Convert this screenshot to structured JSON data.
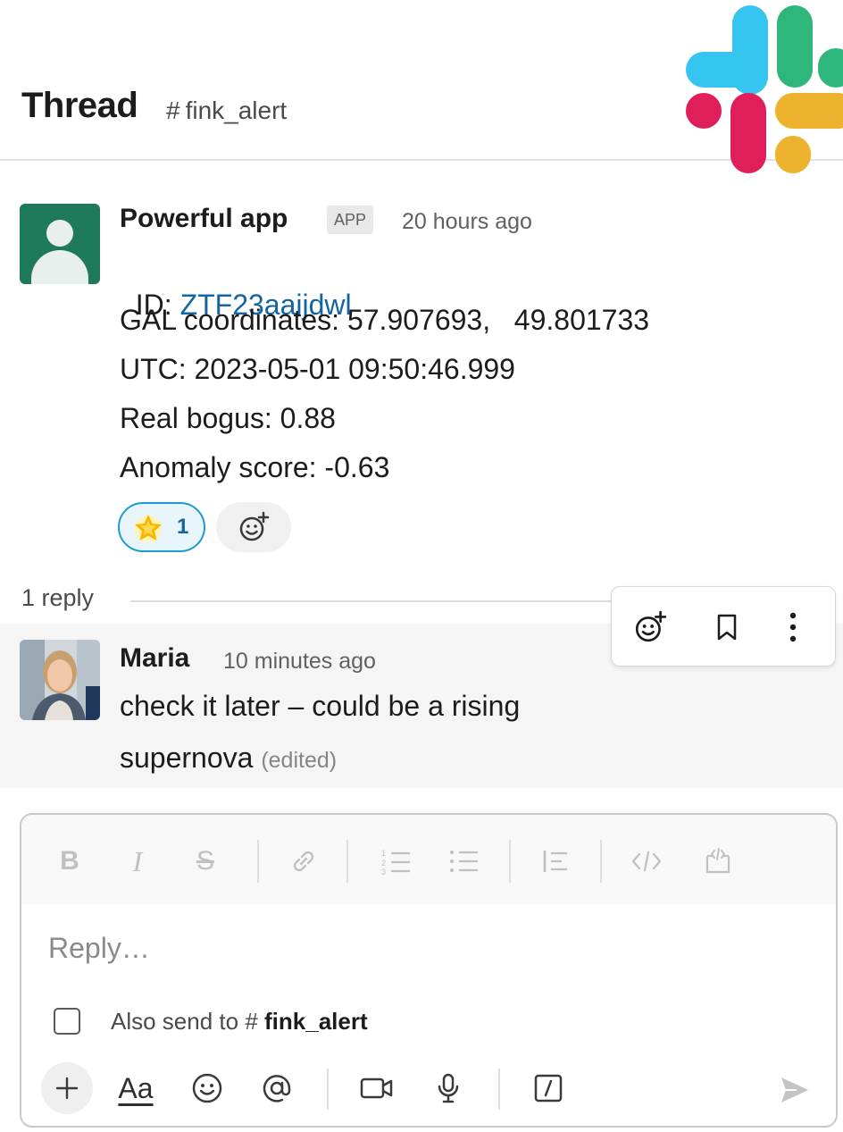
{
  "header": {
    "title": "Thread",
    "channel_hash": "#",
    "channel": "fink_alert",
    "logo_colors": [
      "#36c5f0",
      "#2eb67d",
      "#e01e5a",
      "#ecb22e"
    ]
  },
  "parent_message": {
    "sender": "Powerful app",
    "badge": "APP",
    "timestamp": "20 hours ago",
    "id_label": "ID: ",
    "id_value": "ZTF23aaijdwl",
    "lines": [
      "GAL coordinates: 57.907693,   49.801733",
      "UTC: 2023-05-01 09:50:46.999",
      "Real bogus: 0.88",
      "Anomaly score: -0.63"
    ],
    "reaction": {
      "emoji": "glowing-star",
      "count": "1"
    }
  },
  "reply_count": "1 reply",
  "reply": {
    "sender": "Maria",
    "timestamp": "10 minutes ago",
    "text_line1": "check it later – could be a rising",
    "text_line2": "supernova",
    "edited": "(edited)"
  },
  "hover_toolbar": {
    "icons": [
      "add-reaction-icon",
      "bookmark-icon",
      "more-actions-icon"
    ]
  },
  "composer": {
    "placeholder": "Reply…",
    "also_send_prefix": "Also send to ",
    "also_send_hash": "#",
    "also_send_channel": "fink_alert",
    "aa_label": "Aa",
    "format_buttons": [
      "bold",
      "italic",
      "strikethrough",
      "link",
      "ordered-list",
      "bulleted-list",
      "blockquote",
      "code",
      "code-block"
    ]
  },
  "colors": {
    "link": "#1264a3",
    "reaction_border": "#1d9bd1",
    "app_avatar": "#1f7a5c"
  }
}
